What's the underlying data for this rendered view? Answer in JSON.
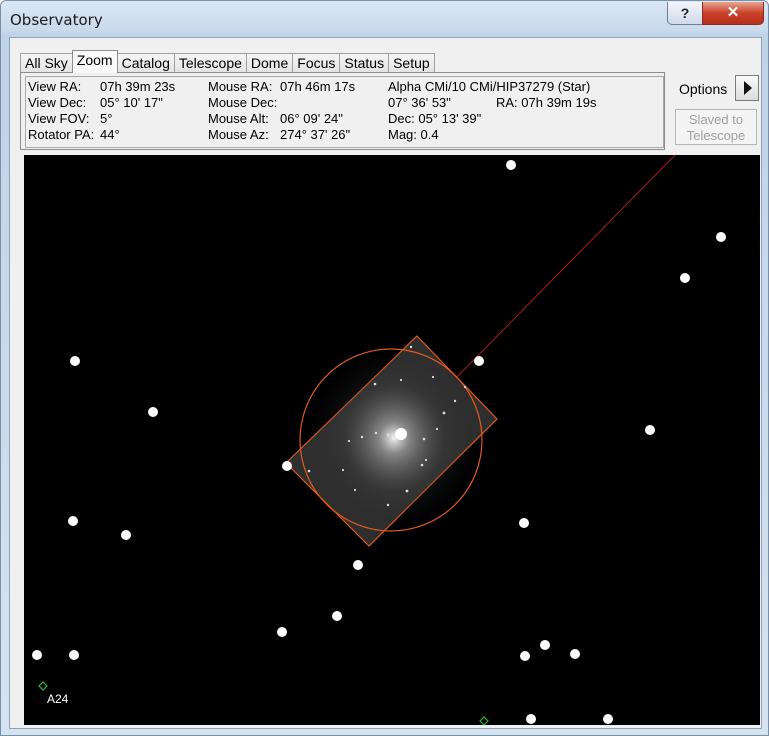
{
  "window": {
    "title": "Observatory",
    "help_glyph": "?",
    "close_glyph": "✕"
  },
  "tabs": [
    {
      "label": "All Sky",
      "active": false
    },
    {
      "label": "Zoom",
      "active": true
    },
    {
      "label": "Catalog",
      "active": false
    },
    {
      "label": "Telescope",
      "active": false
    },
    {
      "label": "Dome",
      "active": false
    },
    {
      "label": "Focus",
      "active": false
    },
    {
      "label": "Status",
      "active": false
    },
    {
      "label": "Setup",
      "active": false
    }
  ],
  "view": {
    "ra_label": "View RA:",
    "ra_value": "07h 39m 23s",
    "dec_label": "View Dec:",
    "dec_value": "05° 10' 17\"",
    "fov_label": "View FOV:",
    "fov_value": "5°",
    "rotator_label": "Rotator PA:",
    "rotator_value": "44°"
  },
  "mouse": {
    "ra_label": "Mouse RA:",
    "ra_value": "07h 46m 17s",
    "dec_label": "Mouse Dec:",
    "dec_value": "",
    "alt_label": "Mouse Alt:",
    "alt_value": "06° 09' 24\"",
    "az_label": "Mouse Az:",
    "az_value": "274° 37' 26\""
  },
  "object": {
    "name": "Alpha CMi/10 CMi/HIP37279 (Star)",
    "line2": "07° 36' 53\"",
    "ra": "RA: 07h 39m 19s",
    "dec": "Dec: 05° 13' 39\"",
    "mag": "Mag: 0.4"
  },
  "options_label": "Options",
  "slaved_label_1": "Slaved to",
  "slaved_label_2": "Telescope",
  "sky": {
    "marker_label": "A24"
  },
  "colors": {
    "sky_bg": "#000000",
    "fov_outline": "#e05a1e",
    "pointer_line": "#b01818",
    "marker": "#2fb82f"
  }
}
